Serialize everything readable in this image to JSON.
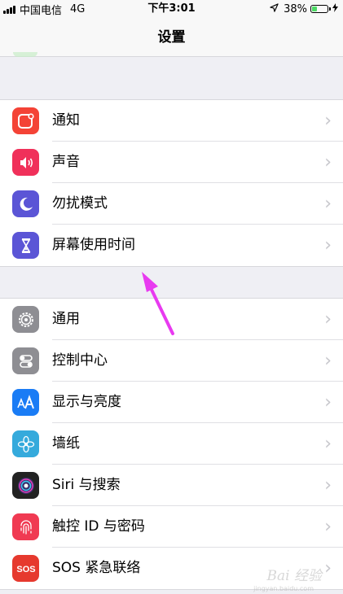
{
  "status_bar": {
    "carrier": "中国电信",
    "network": "4G",
    "time": "下午3:01",
    "battery_percent": "38%",
    "battery_level": 0.38,
    "location_icon": "location-arrow-icon",
    "charging_icon": "bolt-icon"
  },
  "nav": {
    "title": "设置"
  },
  "group1": [
    {
      "label": "通知",
      "icon": "notifications-icon",
      "color": "#f44336"
    },
    {
      "label": "声音",
      "icon": "sound-icon",
      "color": "#f0305a"
    },
    {
      "label": "勿扰模式",
      "icon": "moon-icon",
      "color": "#5b55d6"
    },
    {
      "label": "屏幕使用时间",
      "icon": "hourglass-icon",
      "color": "#5b55d6"
    }
  ],
  "group2": [
    {
      "label": "通用",
      "icon": "gear-icon",
      "color": "#8e8e93"
    },
    {
      "label": "控制中心",
      "icon": "toggles-icon",
      "color": "#8e8e93"
    },
    {
      "label": "显示与亮度",
      "icon": "text-size-icon",
      "color": "#1a7cf5"
    },
    {
      "label": "墙纸",
      "icon": "flower-icon",
      "color": "#35aadc"
    },
    {
      "label": "Siri 与搜索",
      "icon": "siri-icon",
      "color": "#222"
    },
    {
      "label": "触控 ID 与密码",
      "icon": "fingerprint-icon",
      "color": "#f03a52"
    },
    {
      "label": "SOS 紧急联络",
      "icon": "sos-icon",
      "color": "#e6392e"
    }
  ],
  "annotation": {
    "arrow_color": "#e83af0",
    "arrow_icon": "pointer-arrow-icon"
  },
  "watermark": {
    "text": "Bai 经验",
    "subtext": "jingyan.baidu.com"
  }
}
